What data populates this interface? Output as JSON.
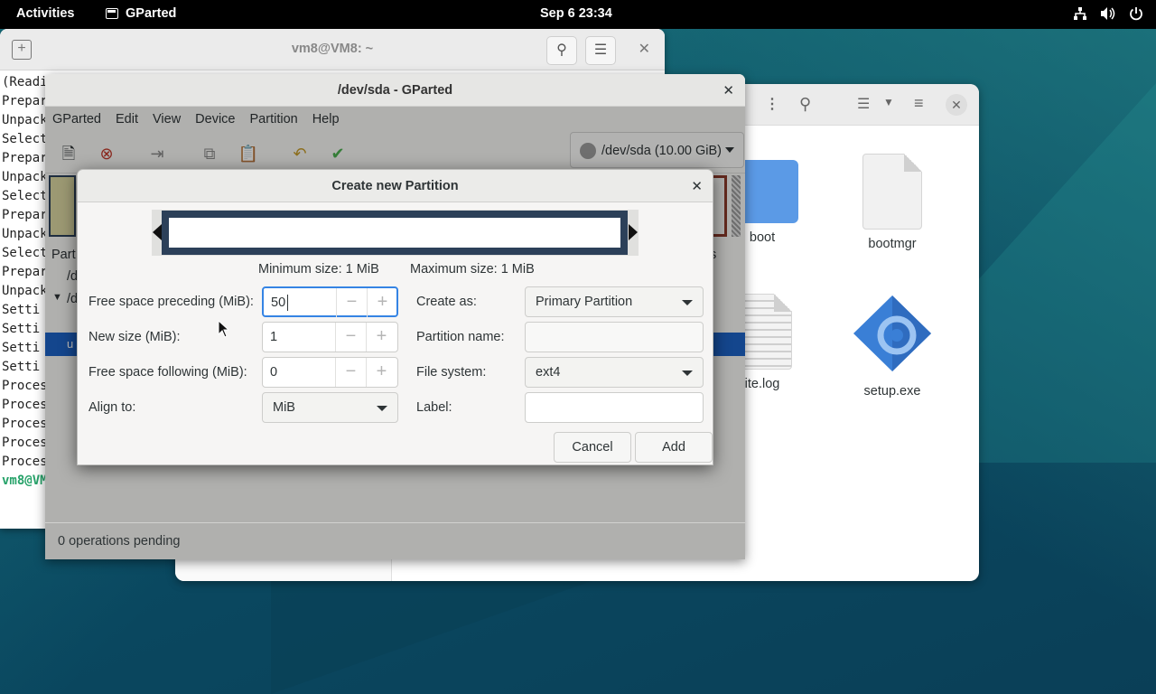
{
  "topbar": {
    "activities": "Activities",
    "app_name": "GParted",
    "clock": "Sep 6  23:34",
    "tray_icons": [
      "network-icon",
      "volume-icon",
      "power-icon"
    ]
  },
  "terminal": {
    "title": "vm8@VM8: ~",
    "lines": [
      "(Readi",
      "Prepar",
      "Unpack",
      "Select",
      "Prepar",
      "Unpack",
      "Select",
      "Prepar",
      "Unpack",
      "Select",
      "Prepar",
      "Unpack",
      "Setti",
      "Setti",
      "Setti",
      "Setti",
      "Proces",
      "Proces",
      "Proces",
      "Proces",
      "Proces"
    ],
    "prompt": "vm8@VM"
  },
  "files": {
    "items": [
      {
        "name": "boot"
      },
      {
        "name": "bootmgr"
      },
      {
        "name": "ite.log"
      },
      {
        "name": "setup.exe"
      }
    ]
  },
  "gparted": {
    "title": "/dev/sda - GParted",
    "menu": [
      "GParted",
      "Edit",
      "View",
      "Device",
      "Partition",
      "Help"
    ],
    "device": "/dev/sda (10.00 GiB)",
    "partial_header": "Part",
    "partial_rows": [
      "/d",
      "/d"
    ],
    "partial_selected": "u",
    "partial_right": "s",
    "status": "0 operations pending"
  },
  "dialog": {
    "title": "Create new Partition",
    "min_size": "Minimum size: 1 MiB",
    "max_size": "Maximum size: 1 MiB",
    "fields": {
      "free_preceding_label": "Free space preceding (MiB):",
      "free_preceding_value": "50",
      "new_size_label": "New size (MiB):",
      "new_size_value": "1",
      "free_following_label": "Free space following (MiB):",
      "free_following_value": "0",
      "align_label": "Align to:",
      "align_value": "MiB",
      "create_as_label": "Create as:",
      "create_as_value": "Primary Partition",
      "partition_name_label": "Partition name:",
      "partition_name_value": "",
      "file_system_label": "File system:",
      "file_system_value": "ext4",
      "label_label": "Label:",
      "label_value": ""
    },
    "cancel": "Cancel",
    "add": "Add"
  },
  "colors": {
    "accent": "#3584e4",
    "partition_border": "#2c4059",
    "selection": "#1c62c4"
  }
}
